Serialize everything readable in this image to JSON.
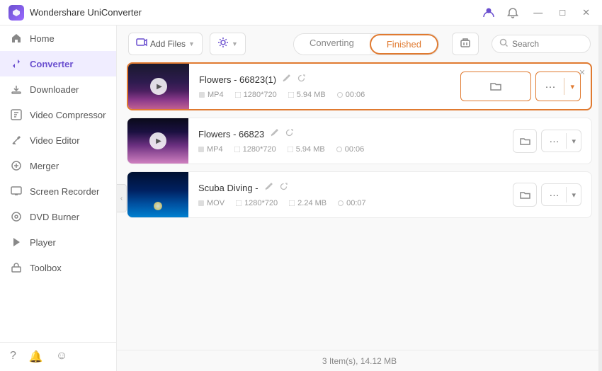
{
  "app": {
    "title": "Wondershare UniConverter",
    "logo_text": "W"
  },
  "titlebar": {
    "controls": [
      "user-icon",
      "notification-icon",
      "minimize-icon",
      "maximize-icon",
      "close-icon"
    ]
  },
  "sidebar": {
    "items": [
      {
        "id": "home",
        "label": "Home",
        "icon": "🏠",
        "active": false
      },
      {
        "id": "converter",
        "label": "Converter",
        "icon": "⇄",
        "active": true
      },
      {
        "id": "downloader",
        "label": "Downloader",
        "icon": "⬇",
        "active": false
      },
      {
        "id": "video-compressor",
        "label": "Video Compressor",
        "icon": "▣",
        "active": false
      },
      {
        "id": "video-editor",
        "label": "Video Editor",
        "icon": "✂",
        "active": false
      },
      {
        "id": "merger",
        "label": "Merger",
        "icon": "⊕",
        "active": false
      },
      {
        "id": "screen-recorder",
        "label": "Screen Recorder",
        "icon": "▶",
        "active": false
      },
      {
        "id": "dvd-burner",
        "label": "DVD Burner",
        "icon": "💿",
        "active": false
      },
      {
        "id": "player",
        "label": "Player",
        "icon": "▷",
        "active": false
      },
      {
        "id": "toolbox",
        "label": "Toolbox",
        "icon": "🔧",
        "active": false
      }
    ],
    "footer_icons": [
      "help-icon",
      "bell-icon",
      "feedback-icon"
    ]
  },
  "toolbar": {
    "add_files_label": "Add Files",
    "add_btn_icon": "📄",
    "settings_btn_icon": "⚙",
    "tab_converting": "Converting",
    "tab_finished": "Finished",
    "search_placeholder": "Search",
    "trash_icon": "🗑"
  },
  "files": [
    {
      "id": "file1",
      "name": "Flowers - 66823(1)",
      "format": "MP4",
      "resolution": "1280*720",
      "size": "5.94 MB",
      "duration": "00:06",
      "thumb_type": "flowers1",
      "first": true
    },
    {
      "id": "file2",
      "name": "Flowers - 66823",
      "format": "MP4",
      "resolution": "1280*720",
      "size": "5.94 MB",
      "duration": "00:06",
      "thumb_type": "flowers2",
      "first": false
    },
    {
      "id": "file3",
      "name": "Scuba Diving -",
      "format": "MOV",
      "resolution": "1280*720",
      "size": "2.24 MB",
      "duration": "00:07",
      "thumb_type": "scuba",
      "first": false
    }
  ],
  "status_bar": {
    "text": "3 Item(s), 14.12 MB"
  }
}
